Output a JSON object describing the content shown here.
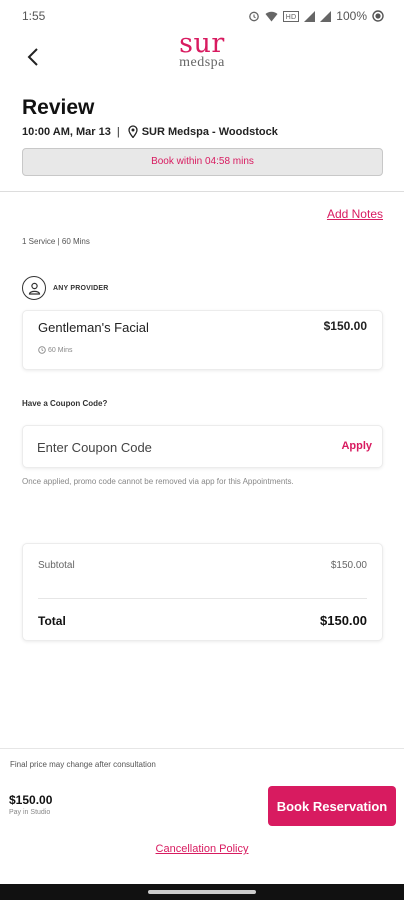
{
  "status_bar": {
    "time": "1:55",
    "battery": "100%"
  },
  "header": {
    "back_icon": "back-arrow-icon",
    "logo_main": "sur",
    "logo_sub": "medspa"
  },
  "review": {
    "title": "Review",
    "datetime": "10:00 AM, Mar 13",
    "separator": "|",
    "location": "SUR Medspa - Woodstock",
    "timer_text": "Book within 04:58 mins"
  },
  "notes": {
    "add_notes_label": "Add Notes"
  },
  "service_summary": "1 Service | 60 Mins",
  "provider": {
    "label": "ANY PROVIDER"
  },
  "service": {
    "name": "Gentleman's Facial",
    "price": "$150.00",
    "duration": "60 Mins"
  },
  "coupon": {
    "question": "Have a Coupon Code?",
    "placeholder": "Enter Coupon Code",
    "apply_label": "Apply",
    "note": "Once applied, promo code cannot be removed via app for this Appointments."
  },
  "summary": {
    "subtotal_label": "Subtotal",
    "subtotal_value": "$150.00",
    "total_label": "Total",
    "total_value": "$150.00"
  },
  "footer": {
    "note": "Final price may change after consultation",
    "price": "$150.00",
    "pay_text": "Pay in Studio",
    "book_label": "Book Reservation",
    "cancellation_label": "Cancellation Policy"
  },
  "colors": {
    "accent": "#d81b60",
    "text": "#222222",
    "muted": "#888888"
  }
}
